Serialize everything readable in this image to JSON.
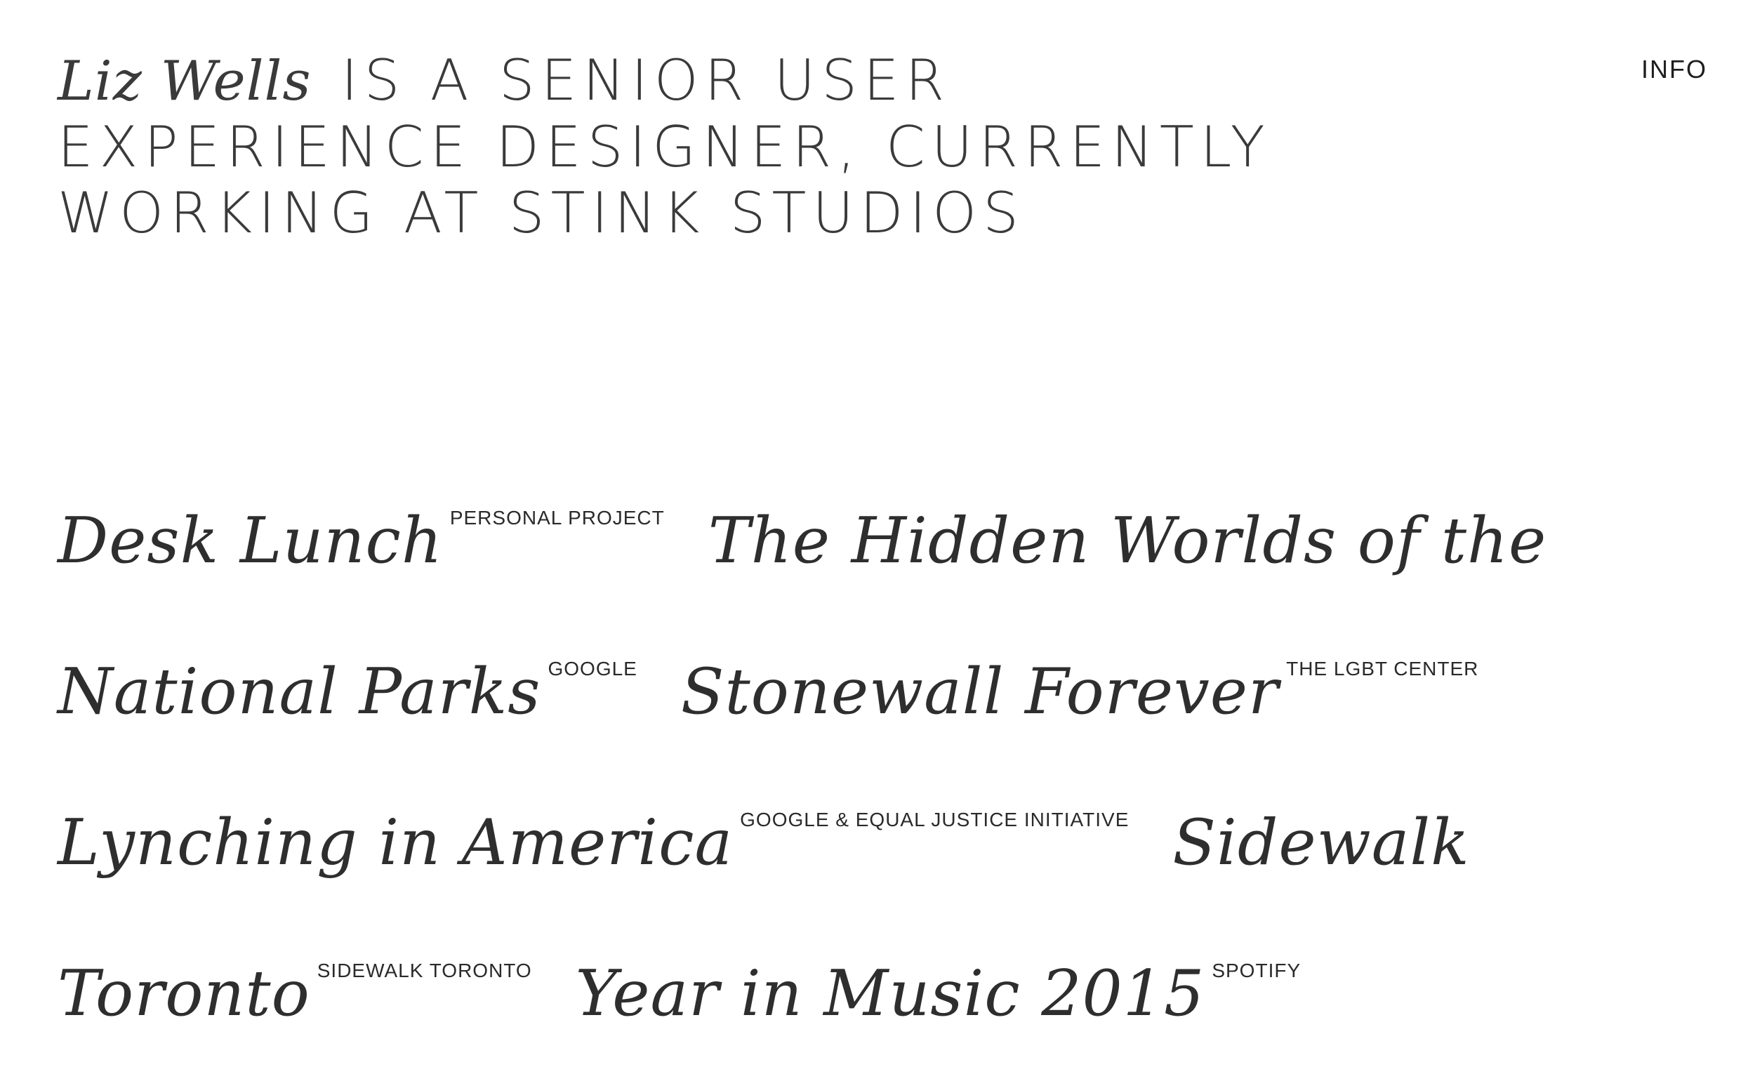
{
  "header": {
    "name": "Liz Wells",
    "bio": "IS A SENIOR USER EXPERIENCE DESIGNER, CURRENTLY WORKING AT STINK STUDIOS",
    "info_label": "INFO"
  },
  "projects": [
    {
      "title": "Desk Lunch",
      "client": "PERSONAL PROJECT"
    },
    {
      "title": "The Hidden Worlds of the National Parks",
      "client": "GOOGLE"
    },
    {
      "title": "Stonewall Forever",
      "client": "THE LGBT CENTER"
    },
    {
      "title": "Lynching in America",
      "client": "GOOGLE & EQUAL JUSTICE INITIATIVE"
    },
    {
      "title": "Sidewalk Toronto",
      "client": "SIDEWALK TORONTO"
    },
    {
      "title": "Year in Music 2015",
      "client": "SPOTIFY"
    }
  ],
  "colors": {
    "background": "#ffffff",
    "text": "#3a3a3a"
  }
}
